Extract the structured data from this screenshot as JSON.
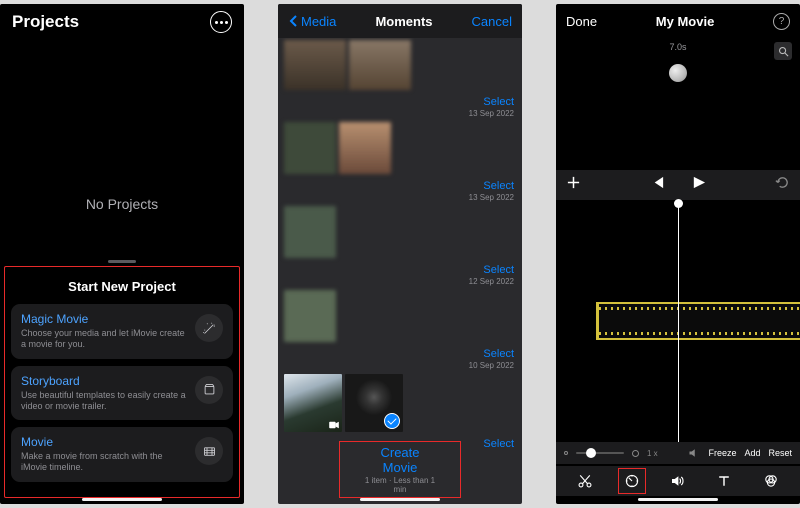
{
  "screen1": {
    "title": "Projects",
    "no_projects": "No Projects",
    "sheet_title": "Start New Project",
    "options": [
      {
        "title": "Magic Movie",
        "subtitle": "Choose your media and let iMovie create a movie for you."
      },
      {
        "title": "Storyboard",
        "subtitle": "Use beautiful templates to easily create a video or movie trailer."
      },
      {
        "title": "Movie",
        "subtitle": "Make a movie from scratch with the iMovie timeline."
      }
    ]
  },
  "screen2": {
    "back": "Media",
    "title": "Moments",
    "cancel": "Cancel",
    "select": "Select",
    "dates": [
      "13 Sep 2022",
      "13 Sep 2022",
      "12 Sep 2022",
      "10 Sep 2022"
    ],
    "create": "Create Movie",
    "create_sub": "1 item · Less than 1 min"
  },
  "screen3": {
    "done": "Done",
    "title": "My Movie",
    "timestamp": "7.0s",
    "zoom_label": "1 x",
    "freeze": "Freeze",
    "add": "Add",
    "reset": "Reset"
  }
}
